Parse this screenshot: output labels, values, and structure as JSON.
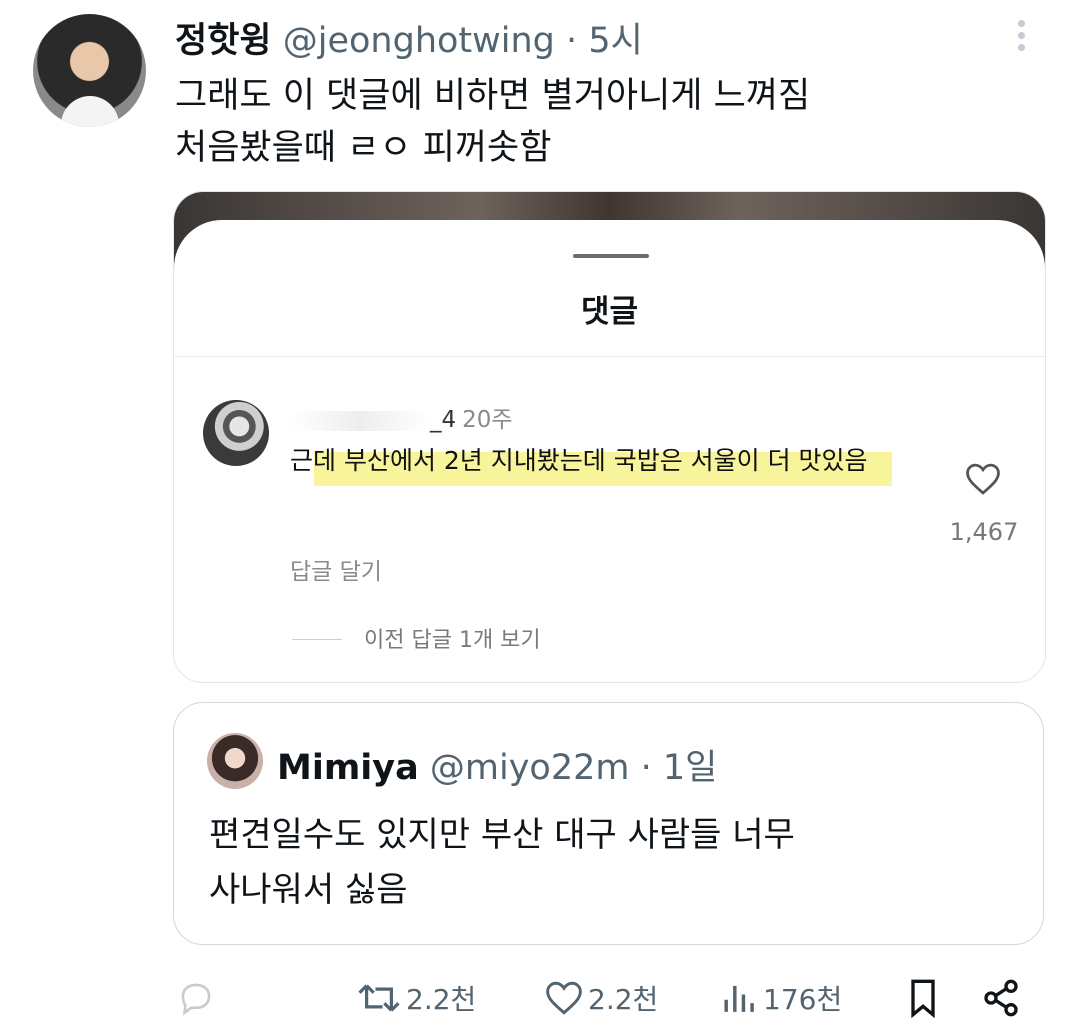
{
  "tweet": {
    "author_name": "정핫윙",
    "author_handle": "@jeonghotwing",
    "separator": "·",
    "time": "5시",
    "text": "그래도 이 댓글에 비하면 별거아니게 느껴짐\n처음봤을때 ㄹㅇ 피꺼솟함"
  },
  "media": {
    "sheet_title": "댓글",
    "comment": {
      "username_suffix": "_4",
      "age": "20주",
      "text": "근데 부산에서 2년 지내봤는데 국밥은 서울이 더 맛있음",
      "reply_label": "답글 달기",
      "likes": "1,467"
    },
    "view_previous": "이전 답글 1개 보기"
  },
  "quote": {
    "author_name": "Mimiya",
    "author_handle": "@miyo22m",
    "separator": "·",
    "time": "1일",
    "text": "편견일수도 있지만 부산 대구 사람들 너무\n사나워서 싫음"
  },
  "actions": {
    "retweets": "2.2천",
    "likes": "2.2천",
    "views": "176천"
  },
  "icons": {
    "reply": "reply-icon",
    "retweet": "retweet-icon",
    "like": "heart-icon",
    "views": "views-icon",
    "bookmark": "bookmark-icon",
    "share": "share-icon",
    "more": "more-icon"
  },
  "colors": {
    "text": "#0f1419",
    "secondary": "#536471",
    "highlight": "#f4f07a"
  }
}
